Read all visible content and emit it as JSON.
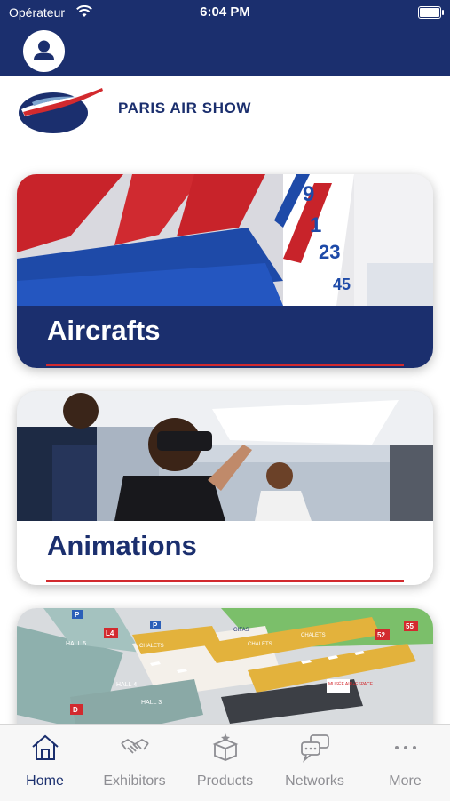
{
  "status_bar": {
    "carrier": "Opérateur",
    "time": "6:04 PM"
  },
  "header": {
    "brand_name": "PARIS AIR SHOW"
  },
  "cards": [
    {
      "title": "Aircrafts"
    },
    {
      "title": "Animations"
    },
    {
      "title": ""
    }
  ],
  "map_labels": [
    "HALL 5",
    "HALL 4",
    "HALL 3",
    "CHALETS",
    "CHALETS",
    "CHALETS",
    "GIFAS",
    "MUSÉE AIR+ESPACE",
    "P",
    "P",
    "L4",
    "52",
    "55",
    "D"
  ],
  "tabs": [
    {
      "label": "Home",
      "icon": "home-icon",
      "active": true
    },
    {
      "label": "Exhibitors",
      "icon": "handshake-icon",
      "active": false
    },
    {
      "label": "Products",
      "icon": "box-icon",
      "active": false
    },
    {
      "label": "Networks",
      "icon": "chat-bubbles-icon",
      "active": false
    },
    {
      "label": "More",
      "icon": "more-dots-icon",
      "active": false
    }
  ],
  "colors": {
    "navy": "#1b2f6e",
    "red": "#d22a2e",
    "tab_inactive": "#8e8e93"
  }
}
